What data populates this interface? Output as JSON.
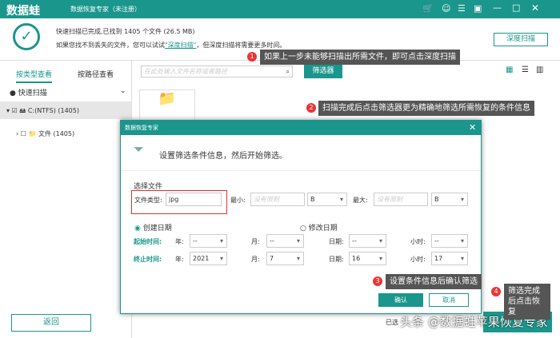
{
  "app": {
    "brand": "数据蛙",
    "title": "数据恢复专家（未注册）"
  },
  "scan": {
    "status": "快速扫描已完成,已找到 1405 个文件 (26.5 MB)",
    "hint_pre": "如果您找不到丢失的文件，您可以试试",
    "hint_link": "\"深度扫描\"",
    "hint_post": "，但深度扫描将需要更多时间。",
    "deep_button": "深度扫描"
  },
  "sidebar": {
    "tabs": [
      "按类型查看",
      "按路径查看"
    ],
    "quick": "快速扫描",
    "drive": "C:(NTFS) (1405)",
    "folder": "文件 (1405)",
    "back": "返回"
  },
  "search": {
    "placeholder": "在此处输入文件名称或者路径",
    "filter_button": "筛选器"
  },
  "dialog": {
    "title": "数据恢复专家",
    "heading": "设置筛选条件信息，然后开始筛选。",
    "section": "选择文件",
    "type_label": "文件类型:",
    "type_value": "jpg",
    "min_label": "最小:",
    "max_label": "最大:",
    "size_placeholder": "没有限制",
    "unit": "B",
    "create_date": "创建日期",
    "modify_date": "修改日期",
    "start": "起始时间:",
    "end": "终止时间:",
    "year": "年:",
    "month": "月:",
    "day": "日期:",
    "hour": "小时:",
    "start_vals": [
      "--",
      "--",
      "--",
      "--"
    ],
    "end_vals": [
      "2021",
      "7",
      "16",
      "17"
    ],
    "ok": "确认",
    "cancel": "取消"
  },
  "tips": [
    "如果上一步未能够扫描出所需文件，即可点击深度扫描",
    "扫描完成后点击筛选器更为精确地筛选所需恢复的条件信息",
    "设置条件信息后确认筛选",
    "筛选完成后点击恢复"
  ],
  "tip_nums": [
    "1",
    "2",
    "3",
    "4"
  ],
  "footer": {
    "selected": "已选",
    "watermark": "头条 @数据蛙苹果恢复专家"
  },
  "colors": {
    "accent": "#1a968c",
    "marker": "#e33333"
  }
}
